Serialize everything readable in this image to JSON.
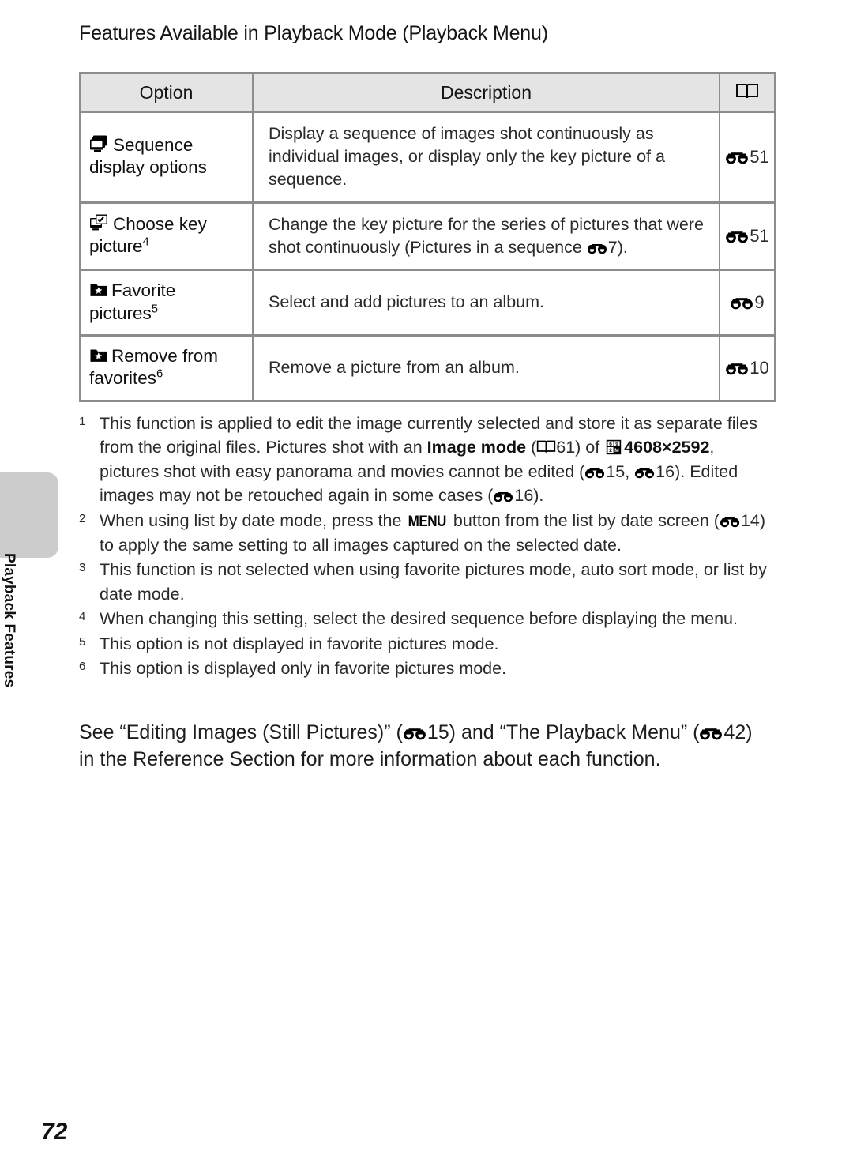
{
  "page": {
    "title": "Features Available in Playback Mode (Playback Menu)",
    "number": "72",
    "side_tab_label": "Playback Features"
  },
  "table": {
    "headers": {
      "option": "Option",
      "description": "Description",
      "reference_icon": "open-book-icon"
    },
    "rows": [
      {
        "icon": "sequence-stack-icon",
        "option": "Sequence display options",
        "option_main": "Sequence",
        "option_second": "display options",
        "footnote": "",
        "description": "Display a sequence of images shot continuously as individual images, or display only the key picture of a sequence.",
        "ref_icon": "reference-section-icon",
        "ref_page": "51"
      },
      {
        "icon": "choose-key-picture-icon",
        "option": "Choose key picture",
        "option_main": "Choose key",
        "option_second": "picture",
        "footnote": "4",
        "description_pre": "Change the key picture for the series of pictures that were shot continuously (Pictures in a sequence ",
        "description_post": "7).",
        "description": "Change the key picture for the series of pictures that were shot continuously (Pictures in a sequence E7).",
        "ref_icon": "reference-section-icon",
        "ref_page": "51"
      },
      {
        "icon": "favorite-folder-icon",
        "option": "Favorite pictures",
        "option_main": "Favorite",
        "option_second": "pictures",
        "footnote": "5",
        "description": "Select and add pictures to an album.",
        "ref_icon": "reference-section-icon",
        "ref_page": "9"
      },
      {
        "icon": "favorite-folder-icon",
        "option": "Remove from favorites",
        "option_main": "Remove from",
        "option_second": "favorites",
        "footnote": "6",
        "description": "Remove a picture from an album.",
        "ref_icon": "reference-section-icon",
        "ref_page": "10"
      }
    ]
  },
  "footnotes": [
    {
      "num": "1",
      "part1": "This function is applied to edit the image currently selected and store it as separate files from the original files. Pictures shot with an ",
      "bold1": "Image mode",
      "part2": " (",
      "ref1": "61) of ",
      "bold2": "4608×2592",
      "part3": ", pictures shot with easy panorama and movies cannot be edited (",
      "ref2": "15, ",
      "ref3": "16). Edited images may not be retouched again in some cases (",
      "ref4": "16)."
    },
    {
      "num": "2",
      "part1": "When using list by date mode, press the ",
      "glyph": "MENU",
      "part2": " button from the list by date screen (",
      "ref1": "14) to apply the same setting to all images captured on the selected date."
    },
    {
      "num": "3",
      "part1": "This function is not selected when using favorite pictures mode, auto sort mode, or list by date mode."
    },
    {
      "num": "4",
      "part1": "When changing this setting, select the desired sequence before displaying the menu."
    },
    {
      "num": "5",
      "part1": "This option is not displayed in favorite pictures mode."
    },
    {
      "num": "6",
      "part1": "This option is displayed only in favorite pictures mode."
    }
  ],
  "closing": {
    "part1": "See “Editing Images (Still Pictures)” (",
    "ref1": "15) and “The Playback Menu” (",
    "ref2": "42) in the Reference Section for more information about each function."
  },
  "colors": {
    "table_border": "#8c8c8c",
    "header_fill": "#e4e4e4",
    "side_tab": "#cccccc",
    "text": "#2a2a2a"
  }
}
